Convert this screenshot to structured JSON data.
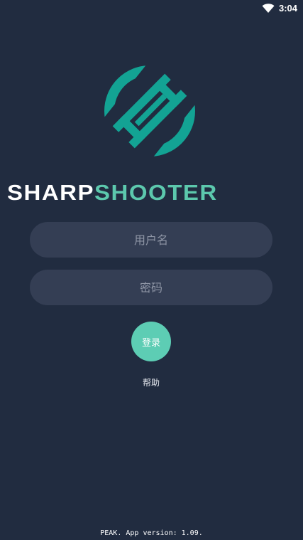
{
  "status_bar": {
    "time": "3:04",
    "wifi_icon": "wifi-icon"
  },
  "logo": {
    "icon": "sharpshooter-logo-icon",
    "brand_first": "SHARP",
    "brand_second": "SHOOTER",
    "colors": {
      "accent": "#5cc8ad",
      "logo_teal": "#13a394"
    }
  },
  "form": {
    "username_placeholder": "用户名",
    "password_placeholder": "密码",
    "login_label": "登录",
    "help_label": "帮助"
  },
  "footer": {
    "version_text": "PEAK. App version: 1.09."
  },
  "colors": {
    "background": "#212c40",
    "input_background": "#343e54",
    "button": "#5dcdb4"
  }
}
